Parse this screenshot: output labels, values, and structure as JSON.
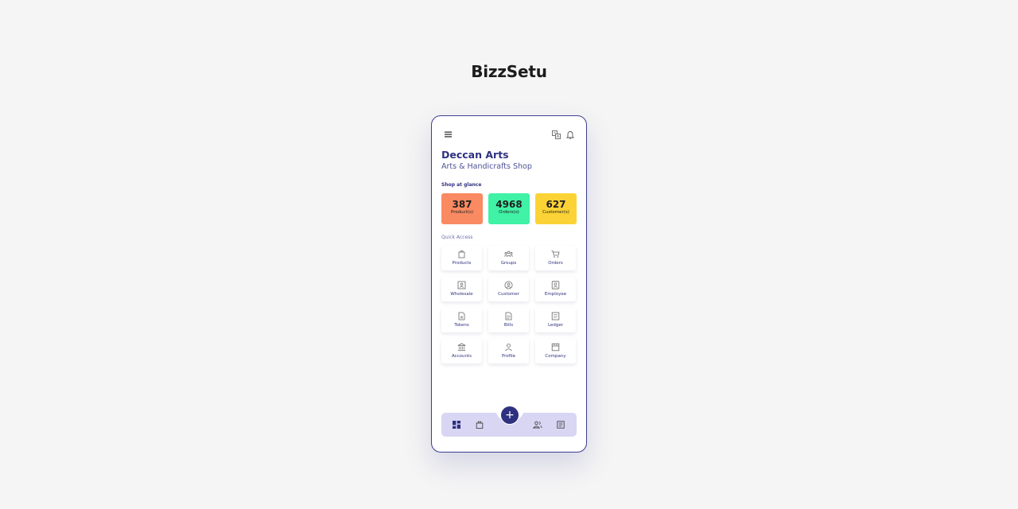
{
  "brand": {
    "title": "BizzSetu"
  },
  "shop": {
    "name": "Deccan Arts",
    "type": "Arts & Handicrafts Shop"
  },
  "glance": {
    "title": "Shop at glance",
    "stats": [
      {
        "value": "387",
        "label": "Product(s)",
        "color": "#fa8a62"
      },
      {
        "value": "4968",
        "label": "Orders(s)",
        "color": "#3ff2a6"
      },
      {
        "value": "627",
        "label": "Customer(s)",
        "color": "#fcd336"
      }
    ]
  },
  "quick_access": {
    "title": "Quick Access",
    "items": [
      {
        "label": "Products",
        "icon": "bag-icon"
      },
      {
        "label": "Groups",
        "icon": "users-icon"
      },
      {
        "label": "Orders",
        "icon": "cart-icon"
      },
      {
        "label": "Wholesale",
        "icon": "id-card-icon"
      },
      {
        "label": "Customer",
        "icon": "user-circle-icon"
      },
      {
        "label": "Employee",
        "icon": "badge-icon"
      },
      {
        "label": "Tokens",
        "icon": "token-icon"
      },
      {
        "label": "Bills",
        "icon": "bill-icon"
      },
      {
        "label": "Ledger",
        "icon": "ledger-icon"
      },
      {
        "label": "Accounts",
        "icon": "bank-icon"
      },
      {
        "label": "Profile",
        "icon": "person-icon"
      },
      {
        "label": "Company",
        "icon": "store-icon"
      }
    ]
  },
  "bottom_nav": {
    "fab_symbol": "+",
    "accent": "#2e3180"
  }
}
